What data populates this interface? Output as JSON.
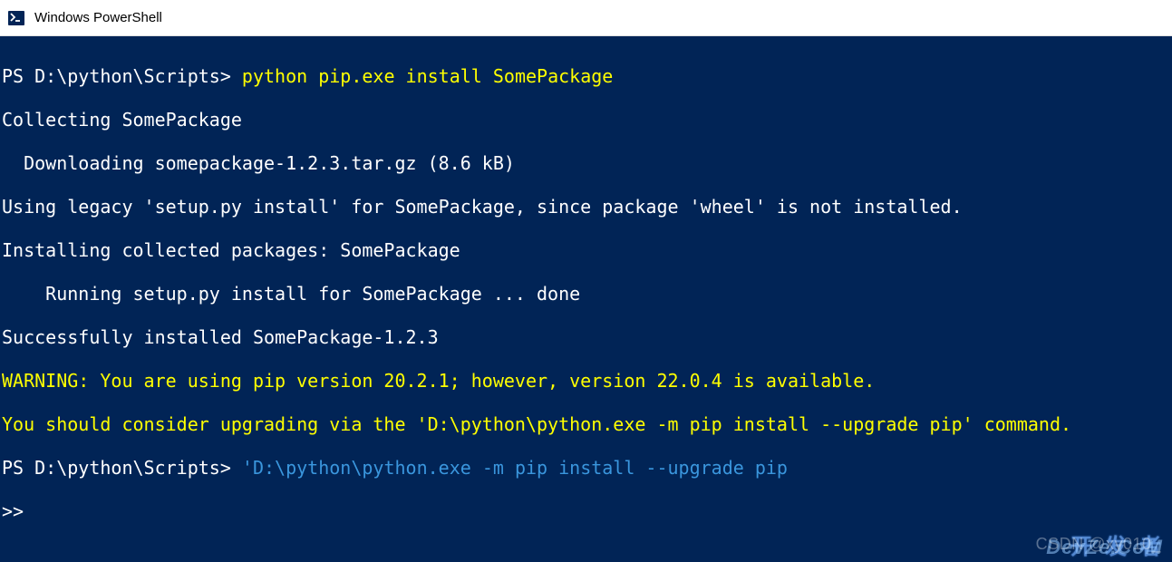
{
  "window": {
    "title": "Windows PowerShell"
  },
  "terminal": {
    "prompt1": "PS D:\\python\\Scripts>",
    "cmd1": " python pip.exe install SomePackage",
    "output": {
      "l1": "Collecting SomePackage",
      "l2": "  Downloading somepackage-1.2.3.tar.gz (8.6 kB)",
      "l3": "Using legacy 'setup.py install' for SomePackage, since package 'wheel' is not installed.",
      "l4": "Installing collected packages: SomePackage",
      "l5": "    Running setup.py install for SomePackage ... done",
      "l6": "Successfully installed SomePackage-1.2.3",
      "l7": "WARNING: You are using pip version 20.2.1; however, version 22.0.4 is available.",
      "l8": "You should consider upgrading via the 'D:\\python\\python.exe -m pip install --upgrade pip' command."
    },
    "prompt2": "PS D:\\python\\Scripts>",
    "cmd2": " 'D:\\python\\python.exe -m pip install --upgrade pip",
    "prompt3": ">>"
  },
  "watermarks": {
    "csdn": "CSDN @xy010_",
    "kaifa": "开 发 者",
    "devze": "DevZe.CoM"
  }
}
